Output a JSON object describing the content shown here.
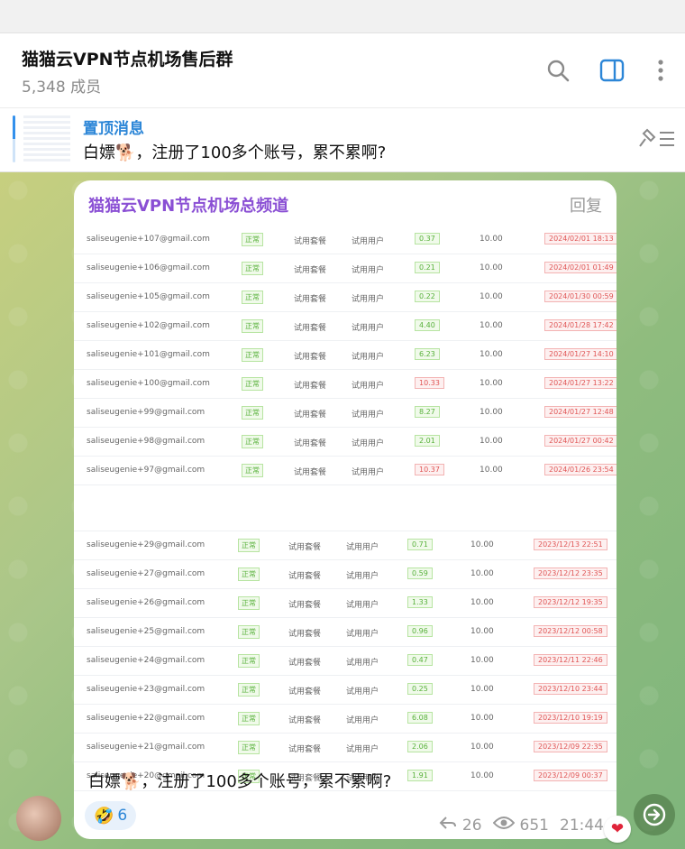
{
  "header": {
    "title": "猫猫云VPN节点机场售后群",
    "members": "5,348 成员"
  },
  "pinned": {
    "title": "置顶消息",
    "text": "白嫖🐕，注册了100多个账号，累不累啊?"
  },
  "message": {
    "forward_from": "猫猫云VPN节点机场总频道",
    "reply_label": "回复",
    "caption": "白嫖🐕，注册了100多个账号，累不累啊?",
    "reaction_emoji": "🤣",
    "reaction_count": "6",
    "forwards": "26",
    "views": "651",
    "time": "21:44",
    "heart": "❤"
  },
  "table_top": [
    {
      "email": "saliseugenie+107@gmail.com",
      "status": "正常",
      "plan": "试用套餐",
      "group": "试用用户",
      "used": "0.37",
      "quota": "10.00",
      "date": "2024/02/01 18:13",
      "red": false
    },
    {
      "email": "saliseugenie+106@gmail.com",
      "status": "正常",
      "plan": "试用套餐",
      "group": "试用用户",
      "used": "0.21",
      "quota": "10.00",
      "date": "2024/02/01 01:49",
      "red": false
    },
    {
      "email": "saliseugenie+105@gmail.com",
      "status": "正常",
      "plan": "试用套餐",
      "group": "试用用户",
      "used": "0.22",
      "quota": "10.00",
      "date": "2024/01/30 00:59",
      "red": false
    },
    {
      "email": "saliseugenie+102@gmail.com",
      "status": "正常",
      "plan": "试用套餐",
      "group": "试用用户",
      "used": "4.40",
      "quota": "10.00",
      "date": "2024/01/28 17:42",
      "red": false
    },
    {
      "email": "saliseugenie+101@gmail.com",
      "status": "正常",
      "plan": "试用套餐",
      "group": "试用用户",
      "used": "6.23",
      "quota": "10.00",
      "date": "2024/01/27 14:10",
      "red": false
    },
    {
      "email": "saliseugenie+100@gmail.com",
      "status": "正常",
      "plan": "试用套餐",
      "group": "试用用户",
      "used": "10.33",
      "quota": "10.00",
      "date": "2024/01/27 13:22",
      "red": true
    },
    {
      "email": "saliseugenie+99@gmail.com",
      "status": "正常",
      "plan": "试用套餐",
      "group": "试用用户",
      "used": "8.27",
      "quota": "10.00",
      "date": "2024/01/27 12:48",
      "red": false
    },
    {
      "email": "saliseugenie+98@gmail.com",
      "status": "正常",
      "plan": "试用套餐",
      "group": "试用用户",
      "used": "2.01",
      "quota": "10.00",
      "date": "2024/01/27 00:42",
      "red": false
    },
    {
      "email": "saliseugenie+97@gmail.com",
      "status": "正常",
      "plan": "试用套餐",
      "group": "试用用户",
      "used": "10.37",
      "quota": "10.00",
      "date": "2024/01/26 23:54",
      "red": true
    }
  ],
  "table_bottom": [
    {
      "email": "saliseugenie+29@gmail.com",
      "status": "正常",
      "plan": "试用套餐",
      "group": "试用用户",
      "used": "0.71",
      "quota": "10.00",
      "date": "2023/12/13 22:51",
      "red": false
    },
    {
      "email": "saliseugenie+27@gmail.com",
      "status": "正常",
      "plan": "试用套餐",
      "group": "试用用户",
      "used": "0.59",
      "quota": "10.00",
      "date": "2023/12/12 23:35",
      "red": false
    },
    {
      "email": "saliseugenie+26@gmail.com",
      "status": "正常",
      "plan": "试用套餐",
      "group": "试用用户",
      "used": "1.33",
      "quota": "10.00",
      "date": "2023/12/12 19:35",
      "red": false
    },
    {
      "email": "saliseugenie+25@gmail.com",
      "status": "正常",
      "plan": "试用套餐",
      "group": "试用用户",
      "used": "0.96",
      "quota": "10.00",
      "date": "2023/12/12 00:58",
      "red": false
    },
    {
      "email": "saliseugenie+24@gmail.com",
      "status": "正常",
      "plan": "试用套餐",
      "group": "试用用户",
      "used": "0.47",
      "quota": "10.00",
      "date": "2023/12/11 22:46",
      "red": false
    },
    {
      "email": "saliseugenie+23@gmail.com",
      "status": "正常",
      "plan": "试用套餐",
      "group": "试用用户",
      "used": "0.25",
      "quota": "10.00",
      "date": "2023/12/10 23:44",
      "red": false
    },
    {
      "email": "saliseugenie+22@gmail.com",
      "status": "正常",
      "plan": "试用套餐",
      "group": "试用用户",
      "used": "6.08",
      "quota": "10.00",
      "date": "2023/12/10 19:19",
      "red": false
    },
    {
      "email": "saliseugenie+21@gmail.com",
      "status": "正常",
      "plan": "试用套餐",
      "group": "试用用户",
      "used": "2.06",
      "quota": "10.00",
      "date": "2023/12/09 22:35",
      "red": false
    },
    {
      "email": "saliseugenie+20@gmail.com",
      "status": "正常",
      "plan": "试用套餐",
      "group": "试用用户",
      "used": "1.91",
      "quota": "10.00",
      "date": "2023/12/09 00:37",
      "red": false
    }
  ],
  "colors": {
    "accent": "#2c86d7",
    "forward_name": "#8a4fd4",
    "ok_green": "#58b13b",
    "warn_red": "#e05555"
  },
  "icons": {
    "search": "search-icon",
    "sidebar_toggle": "sidebar-toggle-icon",
    "more": "more-vertical-icon",
    "pin_list": "pin-list-icon",
    "forward": "forward-arrow-icon",
    "eye": "eye-icon"
  }
}
